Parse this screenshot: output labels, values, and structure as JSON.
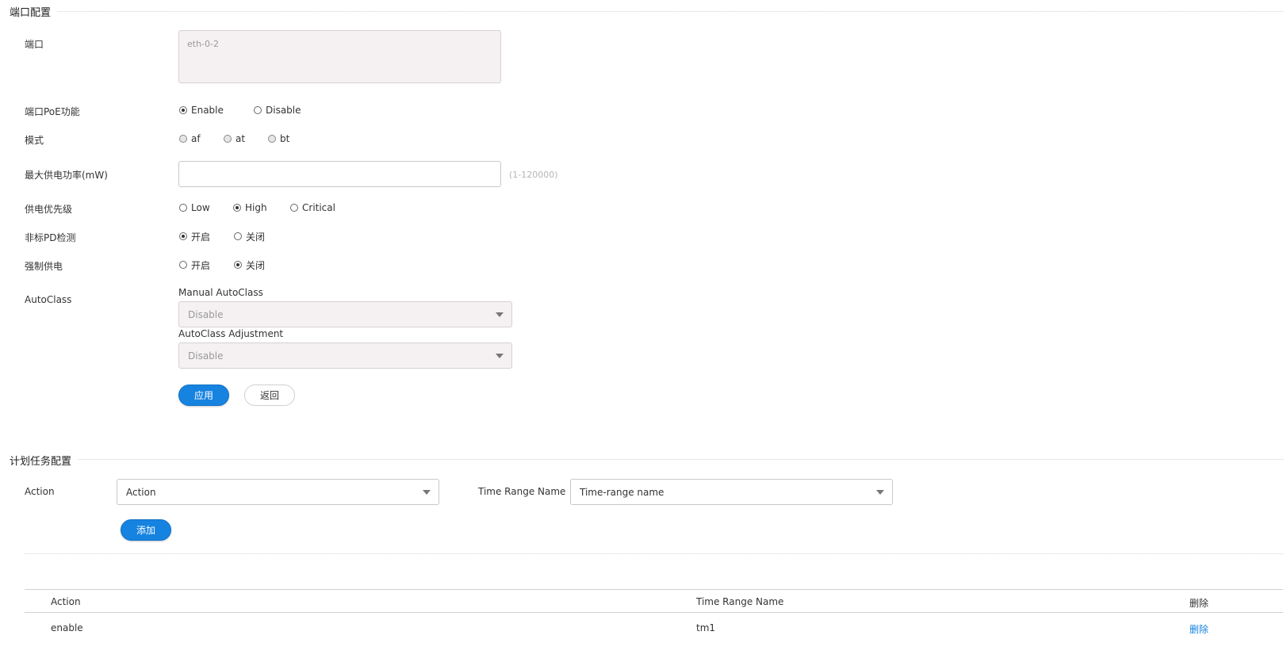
{
  "port_config": {
    "section_title": "端口配置",
    "port": {
      "label": "端口",
      "value": "eth-0-2"
    },
    "poe_function": {
      "label": "端口PoE功能",
      "options": [
        {
          "label": "Enable",
          "checked": true
        },
        {
          "label": "Disable",
          "checked": false
        }
      ]
    },
    "mode": {
      "label": "模式",
      "options": [
        {
          "label": "af",
          "checked": false
        },
        {
          "label": "at",
          "checked": false
        },
        {
          "label": "bt",
          "checked": false
        }
      ]
    },
    "max_power": {
      "label": "最大供电功率(mW)",
      "value": "",
      "hint": "(1-120000)"
    },
    "priority": {
      "label": "供电优先级",
      "options": [
        {
          "label": "Low",
          "checked": false
        },
        {
          "label": "High",
          "checked": true
        },
        {
          "label": "Critical",
          "checked": false
        }
      ]
    },
    "nonstandard_pd": {
      "label": "非标PD检测",
      "options": [
        {
          "label": "开启",
          "checked": true
        },
        {
          "label": "关闭",
          "checked": false
        }
      ]
    },
    "force_power": {
      "label": "强制供电",
      "options": [
        {
          "label": "开启",
          "checked": false
        },
        {
          "label": "关闭",
          "checked": true
        }
      ]
    },
    "autoclass": {
      "label": "AutoClass",
      "manual_label": "Manual AutoClass",
      "manual_value": "Disable",
      "adjustment_label": "AutoClass Adjustment",
      "adjustment_value": "Disable"
    },
    "apply_label": "应用",
    "back_label": "返回"
  },
  "schedule_config": {
    "section_title": "计划任务配置",
    "action_label": "Action",
    "action_value": "Action",
    "time_range_label": "Time Range Name",
    "time_range_value": "Time-range name",
    "add_label": "添加",
    "table": {
      "headers": {
        "action": "Action",
        "time_range": "Time Range Name",
        "delete": "删除"
      },
      "rows": [
        {
          "action": "enable",
          "time_range": "tm1",
          "delete": "删除"
        }
      ]
    }
  },
  "colors": {
    "primary": "#1683e0",
    "disabled_bg": "#f5f1f3"
  }
}
